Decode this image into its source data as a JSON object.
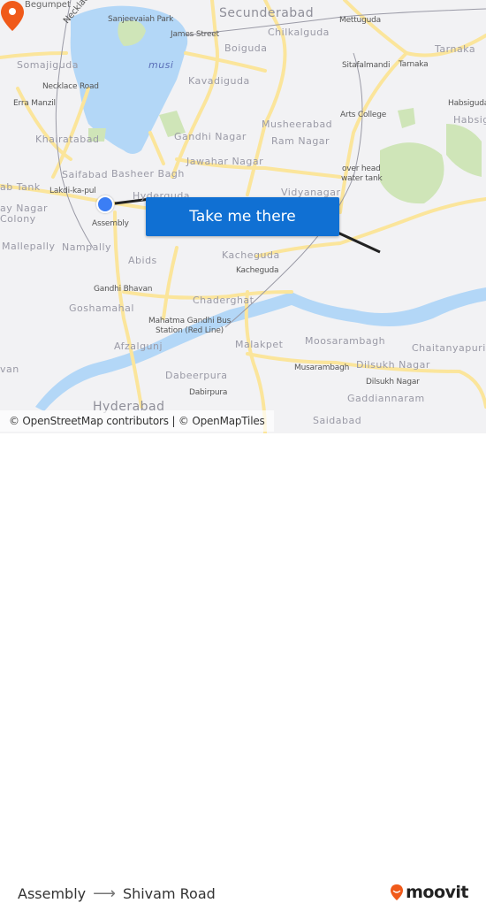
{
  "map": {
    "labels": {
      "begumpet": "Begumpet",
      "necklace_road_diag": "Necklace Road",
      "sanjeevaiah_park": "Sanjeevaiah Park",
      "secunderabad": "Secunderabad",
      "james_street": "James Street",
      "mettuguda": "Mettuguda",
      "chilkalguda": "Chilkalguda",
      "boiguda": "Boiguda",
      "tarnaka_big": "Tarnaka",
      "somajiguda": "Somajiguda",
      "musi": "musi",
      "sitafalmandi": "Sitafalmandi",
      "tarnaka_small": "Tarnaka",
      "kavadiguda": "Kavadiguda",
      "necklace_road": "Necklace Road",
      "erra_manzil": "Erra Manzil",
      "habsiguda_small": "Habsiguda",
      "arts_college": "Arts College",
      "habsiguda_big": "Habsig",
      "musheerabad": "Musheerabad",
      "khairatabad": "Khairatabad",
      "gandhi_nagar": "Gandhi Nagar",
      "ram_nagar": "Ram Nagar",
      "jawahar_nagar": "Jawahar Nagar",
      "saifabad": "Saifabad",
      "basheer_bagh": "Basheer Bagh",
      "over_head_1": "over head",
      "over_head_2": "water tank",
      "ab_tank": "ab Tank",
      "lakdi_ka_pul": "Lakdi-ka-pul",
      "hyderguda": "Hyderguda",
      "vidyanagar": "Vidyanagar",
      "ay_nagar": "ay Nagar",
      "colony": "Colony",
      "assembly": "Assembly",
      "mallepally": "Mallepally",
      "nampally": "Nampally",
      "kacheguda_big": "Kacheguda",
      "kacheguda_small": "Kacheguda",
      "abids": "Abids",
      "gandhi_bhavan": "Gandhi Bhavan",
      "chaderghat": "Chaderghat",
      "goshamahal": "Goshamahal",
      "mg_bus_1": "Mahatma Gandhi Bus",
      "mg_bus_2": "Station (Red Line)",
      "moosarambagh": "Moosarambagh",
      "afzalgunj": "Afzalgunj",
      "malakpet": "Malakpet",
      "chaitanyapuri": "Chaitanyapuri",
      "van": "van",
      "dabeerpura": "Dabeerpura",
      "musarambagh": "Musarambagh",
      "dilsukh_nagar_big": "Dilsukh Nagar",
      "dilsukh_nagar_small": "Dilsukh Nagar",
      "dabirpura": "Dabirpura",
      "gaddiannaram": "Gaddiannaram",
      "hyderabad": "Hyderabad",
      "saidabad": "Saidabad"
    },
    "attribution": "© OpenStreetMap contributors | © OpenMapTiles",
    "cta_label": "Take me there",
    "colors": {
      "water": "#b3d7f7",
      "park": "#cfe5b8",
      "road": "#fbe59b",
      "cta": "#1070d3",
      "origin": "#3b7ef5",
      "destination": "#f05a1a",
      "route_line": "#222222"
    }
  },
  "footer": {
    "origin": "Assembly",
    "arrow": "⟶",
    "destination": "Shivam Road",
    "brand": "moovit",
    "brand_color": "#f05a1a"
  }
}
